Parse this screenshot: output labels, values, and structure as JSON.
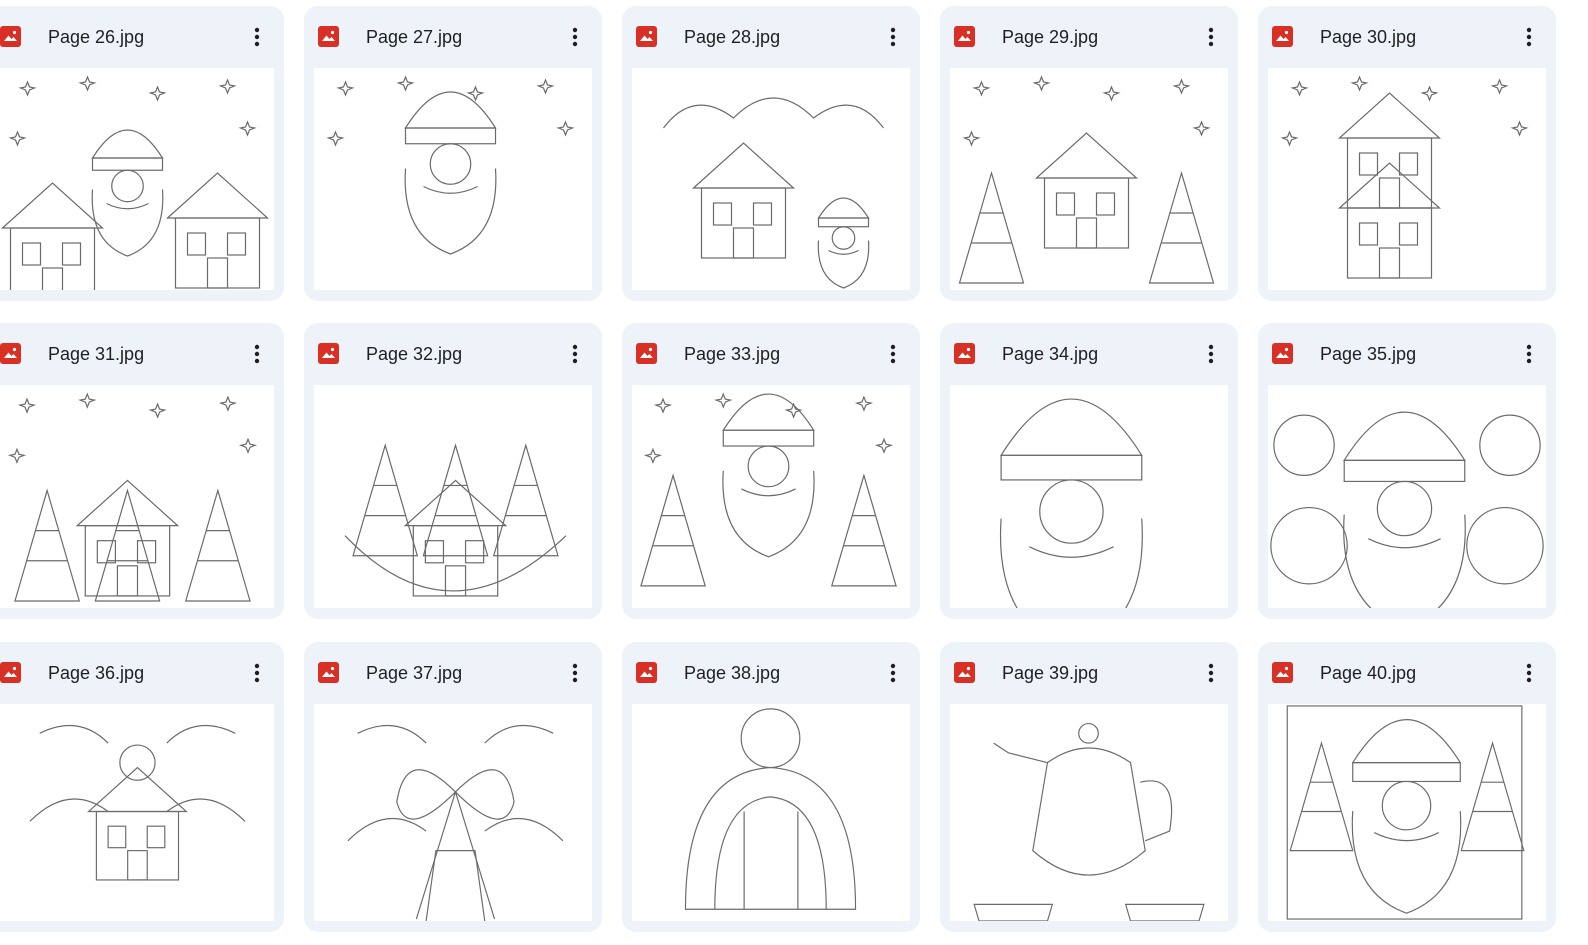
{
  "files": [
    {
      "name": "Page 26.jpg",
      "subject": "santa-castle"
    },
    {
      "name": "Page 27.jpg",
      "subject": "santa-snowflakes"
    },
    {
      "name": "Page 28.jpg",
      "subject": "gingerbread-house"
    },
    {
      "name": "Page 29.jpg",
      "subject": "forest-house"
    },
    {
      "name": "Page 30.jpg",
      "subject": "tall-house"
    },
    {
      "name": "Page 31.jpg",
      "subject": "winter-cottage"
    },
    {
      "name": "Page 32.jpg",
      "subject": "moon-cottage"
    },
    {
      "name": "Page 33.jpg",
      "subject": "santa-forest"
    },
    {
      "name": "Page 34.jpg",
      "subject": "santa-face"
    },
    {
      "name": "Page 35.jpg",
      "subject": "santa-ornaments"
    },
    {
      "name": "Page 36.jpg",
      "subject": "holly-bell-house"
    },
    {
      "name": "Page 37.jpg",
      "subject": "holly-bow"
    },
    {
      "name": "Page 38.jpg",
      "subject": "knit-hat"
    },
    {
      "name": "Page 39.jpg",
      "subject": "teapot-cups"
    },
    {
      "name": "Page 40.jpg",
      "subject": "santa-portrait"
    }
  ],
  "icons": {
    "file_type": "image-file-icon",
    "more": "more-vert-icon"
  },
  "colors": {
    "card_bg": "#eef2f9",
    "icon_red": "#d93025",
    "text": "#1f1f1f",
    "line_art": "#6b6b6b"
  }
}
